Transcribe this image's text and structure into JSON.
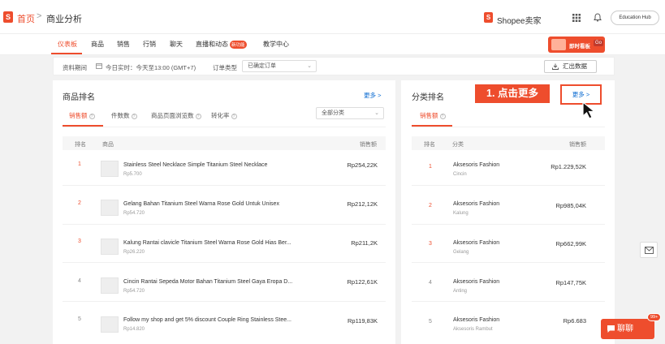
{
  "header": {
    "logo_letter": "S",
    "home": "首页",
    "separator": ">",
    "title": "商业分析",
    "seller_logo_letter": "S",
    "seller_center": "Shopee卖家",
    "education_hub": "Education Hub"
  },
  "nav": {
    "items": [
      "仪表板",
      "商品",
      "销售",
      "行销",
      "聊天",
      "直播和动态",
      "教学中心"
    ],
    "badge": "新功能",
    "promo_text": "即时看板",
    "promo_go": "Go"
  },
  "filters": {
    "period_label": "资料期间",
    "period_value": "今日实时：今天至13:00 (GMT+7)",
    "order_type_label": "订单类型",
    "order_type_value": "已确定订单",
    "export_label": "汇出数据"
  },
  "product_ranking": {
    "title": "商品排名",
    "more": "更多 >",
    "tabs": [
      "销售额",
      "件数数",
      "商品页面浏览数",
      "转化率"
    ],
    "category_select": "全部分类",
    "columns": [
      "排名",
      "商品",
      "销售额"
    ],
    "rows": [
      {
        "rank": "1",
        "name": "Stainless Steel Necklace Simple Titanium Steel Necklace",
        "price": "Rp5.700",
        "sales": "Rp254,22K"
      },
      {
        "rank": "2",
        "name": "Gelang Bahan Titanium Steel Warna Rose Gold Untuk Unisex",
        "price": "Rp54.720",
        "sales": "Rp212,12K"
      },
      {
        "rank": "3",
        "name": "Kalung Rantai clavicle Titanium Steel Warna Rose Gold Hias Ber...",
        "price": "Rp26.220",
        "sales": "Rp211,2K"
      },
      {
        "rank": "4",
        "name": "Cincin Rantai Sepeda Motor Bahan Titanium Steel Gaya Eropa D...",
        "price": "Rp54.720",
        "sales": "Rp122,61K"
      },
      {
        "rank": "5",
        "name": "Follow my shop and get 5% discount Couple Ring Stainless Stee...",
        "price": "Rp14.820",
        "sales": "Rp119,83K"
      }
    ]
  },
  "category_ranking": {
    "title": "分类排名",
    "more": "更多 >",
    "tab": "销售额",
    "columns": [
      "排名",
      "分类",
      "销售额"
    ],
    "rows": [
      {
        "rank": "1",
        "name": "Aksesoris Fashion",
        "sub": "Cincin",
        "sales": "Rp1.229,52K"
      },
      {
        "rank": "2",
        "name": "Aksesoris Fashion",
        "sub": "Kalung",
        "sales": "Rp985,04K"
      },
      {
        "rank": "3",
        "name": "Aksesoris Fashion",
        "sub": "Gelang",
        "sales": "Rp662,99K"
      },
      {
        "rank": "4",
        "name": "Aksesoris Fashion",
        "sub": "Anting",
        "sales": "Rp147,75K"
      },
      {
        "rank": "5",
        "name": "Aksesoris Fashion",
        "sub": "Aksesoris Rambut",
        "sales": "Rp6.683"
      }
    ]
  },
  "callout": {
    "text": "1. 点击更多",
    "box_text": "更多 >"
  },
  "chat": {
    "label": "聊聊",
    "badge": "99+"
  },
  "colors": {
    "accent": "#ee4d2d",
    "link": "#0b6bd1"
  }
}
